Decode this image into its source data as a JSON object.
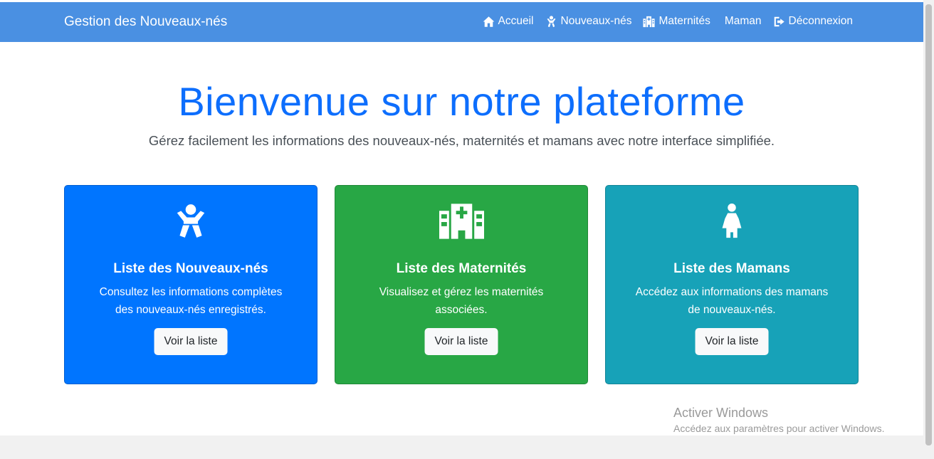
{
  "navbar": {
    "brand": "Gestion des Nouveaux-nés",
    "links": [
      {
        "label": "Accueil",
        "icon": "home-icon"
      },
      {
        "label": "Nouveaux-nés",
        "icon": "baby-icon"
      },
      {
        "label": "Maternités",
        "icon": "hospital-icon"
      },
      {
        "label": "Maman",
        "icon": ""
      },
      {
        "label": "Déconnexion",
        "icon": "sign-out-icon"
      }
    ],
    "color": "#4a90e2"
  },
  "hero": {
    "title": "Bienvenue sur notre plateforme",
    "subtitle": "Gérez facilement les informations des nouveaux-nés, maternités et mamans avec notre interface simplifiée."
  },
  "cards": [
    {
      "title": "Liste des Nouveaux-nés",
      "text": "Consultez les informations complètes des nouveaux-nés enregistrés.",
      "button": "Voir la liste",
      "icon": "baby-icon",
      "color": "#0075ff"
    },
    {
      "title": "Liste des Maternités",
      "text": "Visualisez et gérez les maternités associées.",
      "button": "Voir la liste",
      "icon": "hospital-icon",
      "color": "#28a745"
    },
    {
      "title": "Liste des Mamans",
      "text": "Accédez aux informations des mamans de nouveaux-nés.",
      "button": "Voir la liste",
      "icon": "female-icon",
      "color": "#17a2b8"
    }
  ],
  "watermark": {
    "line1": "Activer Windows",
    "line2": "Accédez aux paramètres pour activer Windows."
  }
}
